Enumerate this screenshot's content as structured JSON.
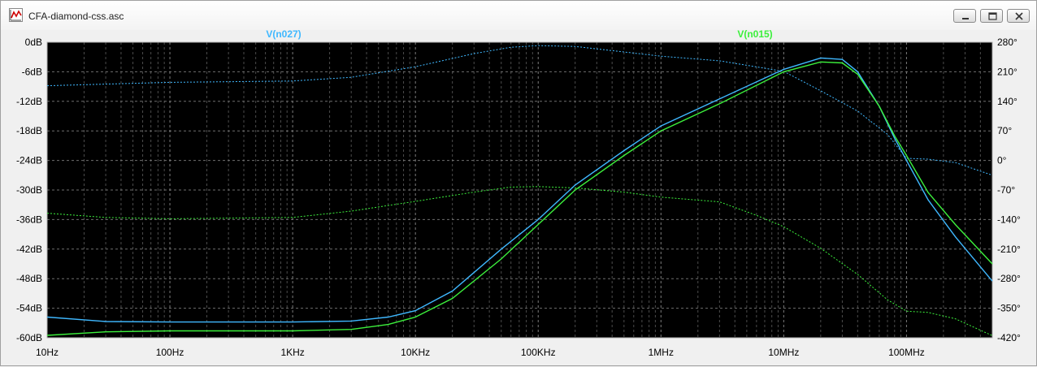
{
  "window": {
    "title": "CFA-diamond-css.asc",
    "app_icon": "waveform-icon",
    "controls": [
      "minimize-icon",
      "restore-icon",
      "close-icon"
    ]
  },
  "chart_data": {
    "type": "line",
    "x_scale": "log",
    "xlim": [
      10,
      500000000
    ],
    "ylim": [
      -60,
      0
    ],
    "y2lim": [
      -420,
      280
    ],
    "grid": true,
    "background": "#000000",
    "legend": "top-center",
    "x_ticks": [
      {
        "value": 10,
        "label": "10Hz"
      },
      {
        "value": 100,
        "label": "100Hz"
      },
      {
        "value": 1000,
        "label": "1KHz"
      },
      {
        "value": 10000,
        "label": "10KHz"
      },
      {
        "value": 100000,
        "label": "100KHz"
      },
      {
        "value": 1000000,
        "label": "1MHz"
      },
      {
        "value": 10000000,
        "label": "10MHz"
      },
      {
        "value": 100000000,
        "label": "100MHz"
      }
    ],
    "y_ticks": [
      {
        "value": 0,
        "label": "0dB"
      },
      {
        "value": -6,
        "label": "-6dB"
      },
      {
        "value": -12,
        "label": "-12dB"
      },
      {
        "value": -18,
        "label": "-18dB"
      },
      {
        "value": -24,
        "label": "-24dB"
      },
      {
        "value": -30,
        "label": "-30dB"
      },
      {
        "value": -36,
        "label": "-36dB"
      },
      {
        "value": -42,
        "label": "-42dB"
      },
      {
        "value": -48,
        "label": "-48dB"
      },
      {
        "value": -54,
        "label": "-54dB"
      },
      {
        "value": -60,
        "label": "-60dB"
      }
    ],
    "y2_ticks": [
      {
        "value": 280,
        "label": "280°"
      },
      {
        "value": 210,
        "label": "210°"
      },
      {
        "value": 140,
        "label": "140°"
      },
      {
        "value": 70,
        "label": "70°"
      },
      {
        "value": 0,
        "label": "0°"
      },
      {
        "value": -70,
        "label": "-70°"
      },
      {
        "value": -140,
        "label": "-140°"
      },
      {
        "value": -210,
        "label": "-210°"
      },
      {
        "value": -280,
        "label": "-280°"
      },
      {
        "value": -350,
        "label": "-350°"
      },
      {
        "value": -420,
        "label": "-420°"
      }
    ],
    "series": [
      {
        "name": "V(n027)",
        "color": "#3fb8ff",
        "magnitude_db": [
          [
            10,
            -55.8
          ],
          [
            30,
            -56.7
          ],
          [
            100,
            -56.8
          ],
          [
            1000,
            -56.8
          ],
          [
            3000,
            -56.6
          ],
          [
            6000,
            -55.8
          ],
          [
            10000,
            -54.5
          ],
          [
            20000,
            -50.5
          ],
          [
            50000,
            -42.0
          ],
          [
            100000,
            -36.0
          ],
          [
            200000,
            -29.0
          ],
          [
            500000,
            -22.0
          ],
          [
            1000000,
            -17.0
          ],
          [
            3000000,
            -11.5
          ],
          [
            10000000,
            -5.5
          ],
          [
            20000000,
            -3.2
          ],
          [
            30000000,
            -3.5
          ],
          [
            40000000,
            -6.0
          ],
          [
            60000000,
            -13.0
          ],
          [
            80000000,
            -19.5
          ],
          [
            100000000,
            -24.0
          ],
          [
            150000000,
            -32.0
          ],
          [
            250000000,
            -39.5
          ],
          [
            500000000,
            -48.5
          ]
        ],
        "phase_deg": [
          [
            10,
            177
          ],
          [
            100,
            185
          ],
          [
            1000,
            188
          ],
          [
            3000,
            197
          ],
          [
            10000,
            222
          ],
          [
            30000,
            253
          ],
          [
            60000,
            268
          ],
          [
            100000,
            272
          ],
          [
            200000,
            270
          ],
          [
            500000,
            257
          ],
          [
            1000000,
            247
          ],
          [
            3000000,
            236
          ],
          [
            10000000,
            211
          ],
          [
            20000000,
            165
          ],
          [
            40000000,
            117
          ],
          [
            70000000,
            62
          ],
          [
            100000000,
            5
          ],
          [
            150000000,
            3
          ],
          [
            250000000,
            -5
          ],
          [
            500000000,
            -35
          ]
        ]
      },
      {
        "name": "V(n015)",
        "color": "#3cf03c",
        "magnitude_db": [
          [
            10,
            -59.5
          ],
          [
            30,
            -58.8
          ],
          [
            100,
            -58.6
          ],
          [
            1000,
            -58.6
          ],
          [
            3000,
            -58.3
          ],
          [
            6000,
            -57.3
          ],
          [
            10000,
            -55.8
          ],
          [
            20000,
            -52.0
          ],
          [
            50000,
            -44.0
          ],
          [
            100000,
            -37.0
          ],
          [
            200000,
            -30.0
          ],
          [
            500000,
            -23.0
          ],
          [
            1000000,
            -18.0
          ],
          [
            3000000,
            -12.5
          ],
          [
            10000000,
            -6.0
          ],
          [
            20000000,
            -4.0
          ],
          [
            30000000,
            -4.2
          ],
          [
            40000000,
            -6.5
          ],
          [
            60000000,
            -13.0
          ],
          [
            80000000,
            -19.0
          ],
          [
            100000000,
            -23.0
          ],
          [
            150000000,
            -30.5
          ],
          [
            250000000,
            -37.0
          ],
          [
            500000000,
            -45.0
          ]
        ],
        "phase_deg": [
          [
            10,
            -125
          ],
          [
            30,
            -135
          ],
          [
            100,
            -138
          ],
          [
            1000,
            -135
          ],
          [
            3000,
            -120
          ],
          [
            10000,
            -97
          ],
          [
            30000,
            -75
          ],
          [
            60000,
            -63
          ],
          [
            100000,
            -62
          ],
          [
            200000,
            -65
          ],
          [
            500000,
            -75
          ],
          [
            1000000,
            -87
          ],
          [
            3000000,
            -98
          ],
          [
            6000000,
            -130
          ],
          [
            10000000,
            -157
          ],
          [
            20000000,
            -208
          ],
          [
            40000000,
            -270
          ],
          [
            70000000,
            -330
          ],
          [
            100000000,
            -357
          ],
          [
            150000000,
            -360
          ],
          [
            250000000,
            -375
          ],
          [
            500000000,
            -415
          ]
        ]
      }
    ]
  }
}
